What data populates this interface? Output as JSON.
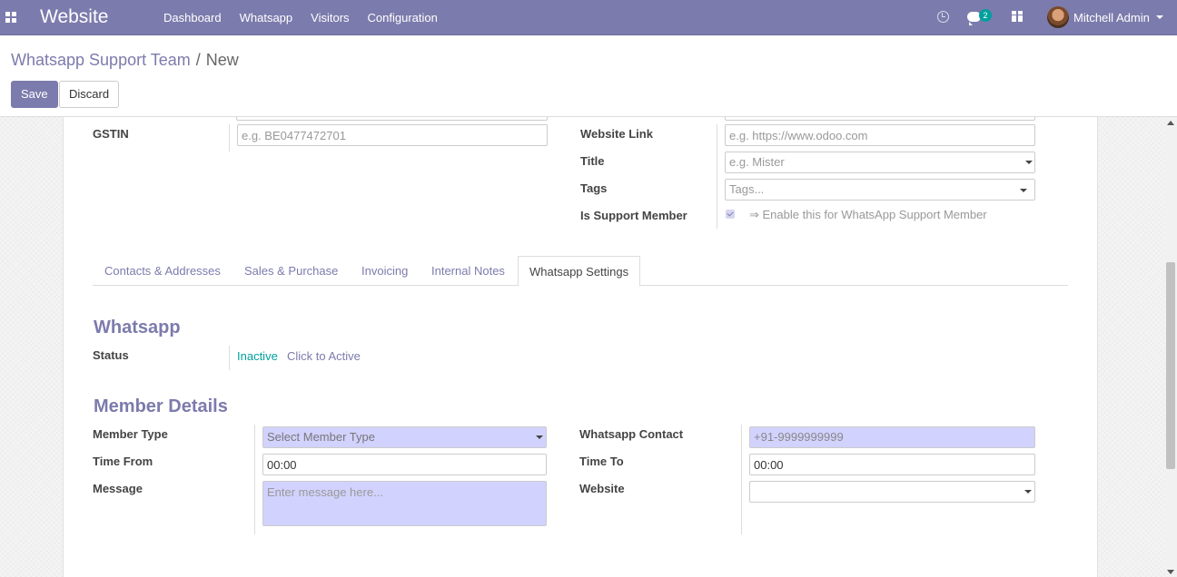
{
  "navbar": {
    "brand": "Website",
    "menu": [
      "Dashboard",
      "Whatsapp",
      "Visitors",
      "Configuration"
    ],
    "chat_badge": "2",
    "user": "Mitchell Admin",
    "colors": {
      "primary": "#7c7bad",
      "badge": "#00a09d"
    }
  },
  "breadcrumb": {
    "parent": "Whatsapp Support Team",
    "separator": "/",
    "current": "New"
  },
  "buttons": {
    "save": "Save",
    "discard": "Discard"
  },
  "form": {
    "gstin_label": "GSTIN",
    "gstin_placeholder": "e.g. BE0477472701",
    "website_link_label": "Website Link",
    "website_link_placeholder": "e.g. https://www.odoo.com",
    "title_label": "Title",
    "title_placeholder": "e.g. Mister",
    "tags_label": "Tags",
    "tags_placeholder": "Tags...",
    "support_member_label": "Is Support Member",
    "support_member_checked": true,
    "support_member_hint": "⇒ Enable this for WhatsApp Support Member"
  },
  "tabs": [
    "Contacts & Addresses",
    "Sales & Purchase",
    "Invoicing",
    "Internal Notes",
    "Whatsapp Settings"
  ],
  "whatsapp": {
    "title": "Whatsapp",
    "status_label": "Status",
    "status_value": "Inactive",
    "status_action": "Click to Active"
  },
  "member": {
    "title": "Member Details",
    "member_type_label": "Member Type",
    "member_type_placeholder": "Select Member Type",
    "time_from_label": "Time From",
    "time_from_value": "00:00",
    "message_label": "Message",
    "message_placeholder": "Enter message here...",
    "contact_label": "Whatsapp Contact",
    "contact_placeholder": "+91-9999999999",
    "time_to_label": "Time To",
    "time_to_value": "00:00",
    "website_label": "Website",
    "website_value": ""
  }
}
